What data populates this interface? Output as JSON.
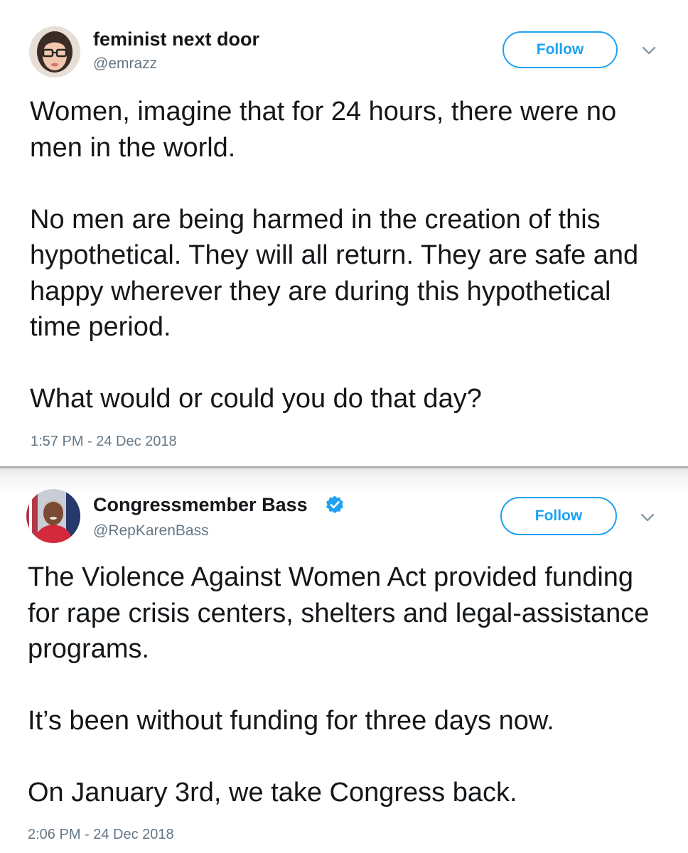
{
  "tweets": [
    {
      "display_name": "feminist next door",
      "handle": "@emrazz",
      "follow_label": "Follow",
      "text": "Women, imagine that for 24 hours, there were no men in the world.\n\nNo men are being harmed in the creation of this hypothetical. They will all return. They are safe and happy wherever they are during this hypothetical time period.\n\nWhat would or could you do that day?",
      "timestamp": "1:57 PM - 24 Dec 2018",
      "verified": false
    },
    {
      "display_name": "Congressmember Bass",
      "handle": "@RepKarenBass",
      "follow_label": "Follow",
      "text": "The Violence Against Women Act provided funding for rape crisis centers, shelters and legal-assistance programs.\n\nIt’s been without funding for three days now.\n\nOn January 3rd, we take Congress back.",
      "timestamp": "2:06 PM - 24 Dec 2018",
      "verified": true
    }
  ],
  "colors": {
    "accent": "#1da1f2",
    "text": "#14171a",
    "secondary": "#657786"
  },
  "icons": [
    "avatar",
    "verified-badge-icon",
    "chevron-down-icon"
  ]
}
